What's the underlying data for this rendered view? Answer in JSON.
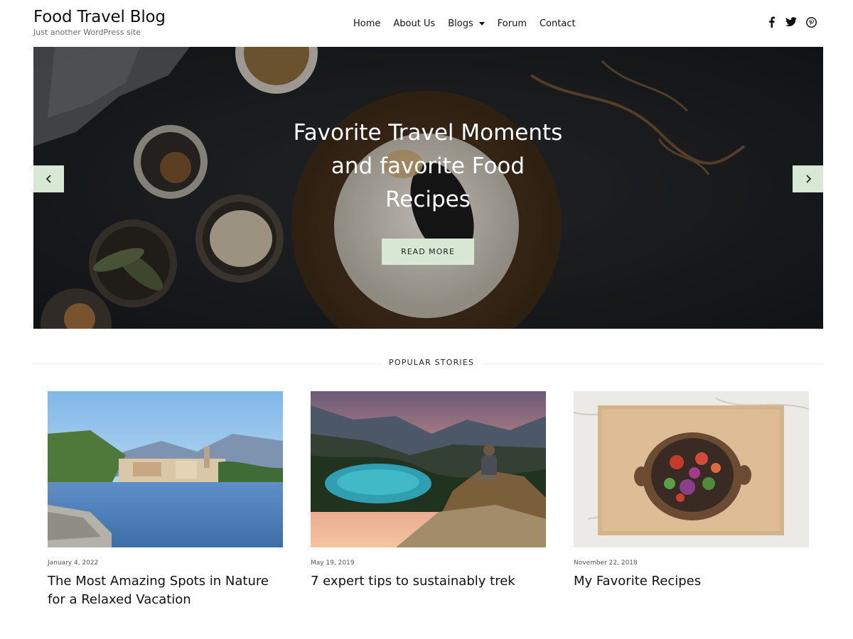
{
  "header": {
    "site_title": "Food Travel Blog",
    "tagline": "Just another WordPress site"
  },
  "nav": {
    "home": "Home",
    "about": "About Us",
    "blogs": "Blogs",
    "forum": "Forum",
    "contact": "Contact"
  },
  "social": {
    "facebook": "f",
    "icons": [
      "facebook-icon",
      "twitter-icon",
      "pinterest-icon"
    ]
  },
  "hero": {
    "title": "Favorite Travel Moments and favorite Food Recipes",
    "button": "READ MORE"
  },
  "popular": {
    "heading": "POPULAR STORIES",
    "posts": [
      {
        "date": "January 4, 2022",
        "title": "The Most Amazing Spots in Nature for a Relaxed Vacation"
      },
      {
        "date": "May 19, 2019",
        "title": "7 expert tips to sustainably trek"
      },
      {
        "date": "November 22, 2018",
        "title": "My Favorite Recipes"
      }
    ]
  },
  "colors": {
    "accent": "#d9e8d4",
    "text": "#111111",
    "hero_bg": "#1d2226"
  }
}
